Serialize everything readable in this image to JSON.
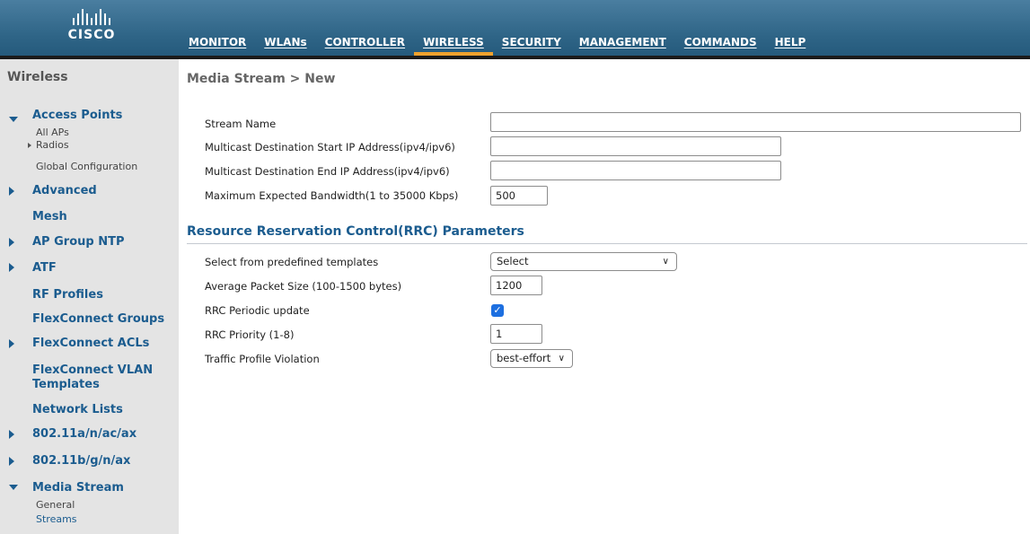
{
  "brand": {
    "logo_text": "CISCO"
  },
  "nav": [
    {
      "label": "MONITOR"
    },
    {
      "label": "WLANs"
    },
    {
      "label": "CONTROLLER"
    },
    {
      "label": "WIRELESS"
    },
    {
      "label": "SECURITY"
    },
    {
      "label": "MANAGEMENT"
    },
    {
      "label": "COMMANDS"
    },
    {
      "label": "HELP"
    }
  ],
  "nav_active": "WIRELESS",
  "sidebar": {
    "title": "Wireless",
    "items": [
      {
        "label": "Access Points",
        "expanded": true
      },
      {
        "label": "Advanced"
      },
      {
        "label": "Mesh"
      },
      {
        "label": "AP Group NTP"
      },
      {
        "label": "ATF"
      },
      {
        "label": "RF Profiles"
      },
      {
        "label": "FlexConnect Groups"
      },
      {
        "label": "FlexConnect ACLs"
      },
      {
        "label": "FlexConnect VLAN Templates"
      },
      {
        "label": "Network Lists"
      },
      {
        "label": "802.11a/n/ac/ax"
      },
      {
        "label": "802.11b/g/n/ax"
      },
      {
        "label": "Media Stream",
        "expanded": true
      }
    ],
    "access_points_sub": [
      "All APs",
      "Radios",
      "Global Configuration"
    ],
    "media_stream_sub": [
      "General",
      "Streams"
    ]
  },
  "page": {
    "title": "Media Stream > New",
    "fields": {
      "stream_name": {
        "label": "Stream Name",
        "value": ""
      },
      "start_ip": {
        "label": "Multicast Destination Start IP Address(ipv4/ipv6)",
        "value": ""
      },
      "end_ip": {
        "label": "Multicast Destination End IP Address(ipv4/ipv6)",
        "value": ""
      },
      "bandwidth": {
        "label": "Maximum Expected Bandwidth(1 to 35000 Kbps)",
        "value": "500"
      }
    },
    "rrc": {
      "title": "Resource Reservation Control(RRC) Parameters",
      "template": {
        "label": "Select from predefined templates",
        "value": "Select"
      },
      "packet_size": {
        "label": "Average Packet Size (100-1500 bytes)",
        "value": "1200"
      },
      "periodic_update": {
        "label": "RRC Periodic update",
        "checked": true
      },
      "priority": {
        "label": "RRC Priority (1-8)",
        "value": "1"
      },
      "violation": {
        "label": "Traffic Profile Violation",
        "value": "best-effort"
      }
    }
  },
  "colors": {
    "accent": "#f0a22e",
    "link": "#1b5c8f",
    "checkbox": "#1d6fe0"
  }
}
